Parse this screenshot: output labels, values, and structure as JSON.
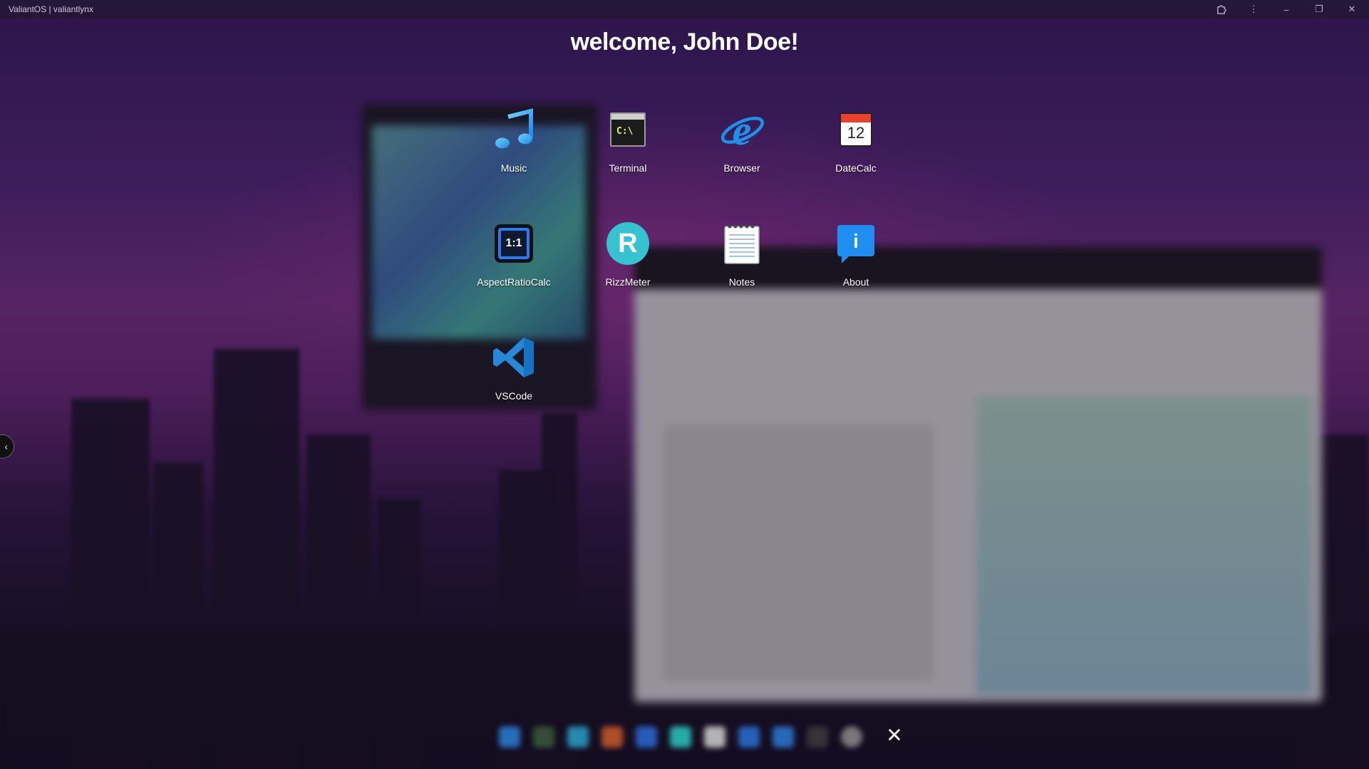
{
  "window": {
    "title": "ValiantOS | valiantlynx",
    "controls": {
      "extension_icon": "puzzle-icon",
      "menu_icon": "⋮",
      "minimize_icon": "–",
      "restore_icon": "❐",
      "close_icon": "✕"
    }
  },
  "welcome": {
    "text": "welcome, John Doe!"
  },
  "apps": [
    {
      "label": "Music",
      "icon": "music-note-icon"
    },
    {
      "label": "Terminal",
      "icon": "terminal-icon",
      "icon_text": "C:\\"
    },
    {
      "label": "Browser",
      "icon": "browser-e-icon"
    },
    {
      "label": "DateCalc",
      "icon": "calendar-icon",
      "icon_text": "12"
    },
    {
      "label": "AspectRatioCalc",
      "icon": "aspect-ratio-icon",
      "icon_text": "1:1"
    },
    {
      "label": "RizzMeter",
      "icon": "rizz-icon",
      "icon_text": "R"
    },
    {
      "label": "Notes",
      "icon": "notepad-icon"
    },
    {
      "label": "About",
      "icon": "info-icon",
      "icon_text": "i"
    },
    {
      "label": "VSCode",
      "icon": "vscode-icon"
    }
  ],
  "overlay": {
    "close_icon": "✕",
    "side_handle_icon": "‹"
  },
  "colors": {
    "accent_blue": "#1e90e8",
    "teal": "#35c3d1",
    "title_bar": "#241737"
  }
}
